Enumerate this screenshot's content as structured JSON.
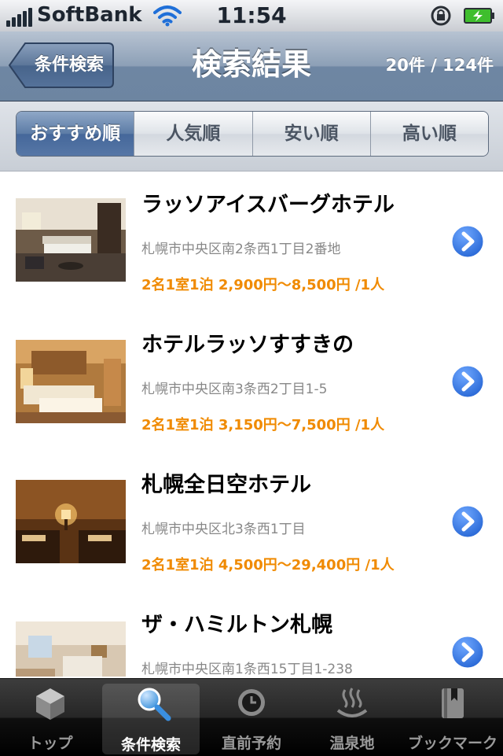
{
  "status": {
    "carrier": "SoftBank",
    "time": "11:54",
    "signal_bars": 5,
    "icons": [
      "signal-bars-icon",
      "wifi-icon",
      "orientation-lock-icon",
      "battery-charging-icon"
    ]
  },
  "nav": {
    "back_label": "条件検索",
    "title": "検索結果",
    "count": "20件 / 124件"
  },
  "sort": {
    "options": [
      "おすすめ順",
      "人気順",
      "安い順",
      "高い順"
    ],
    "selected": "おすすめ順"
  },
  "hotels": [
    {
      "name": "ラッソアイスバーグホテル",
      "address": "札幌市中央区南2条西1丁目2番地",
      "price": "2名1室1泊 2,900円〜8,500円 /1人"
    },
    {
      "name": "ホテルラッソすすきの",
      "address": "札幌市中央区南3条西2丁目1-5",
      "price": "2名1室1泊 3,150円〜7,500円 /1人"
    },
    {
      "name": "札幌全日空ホテル",
      "address": "札幌市中央区北3条西1丁目",
      "price": "2名1室1泊 4,500円〜29,400円 /1人"
    },
    {
      "name": "ザ・ハミルトン札幌",
      "address": "札幌市中央区南1条西15丁目1-238",
      "price": ""
    }
  ],
  "tabs": [
    {
      "label": "トップ",
      "icon": "box-icon"
    },
    {
      "label": "条件検索",
      "icon": "search-icon"
    },
    {
      "label": "直前予約",
      "icon": "clock-icon"
    },
    {
      "label": "温泉地",
      "icon": "hot-spring-icon"
    },
    {
      "label": "ブックマーク",
      "icon": "bookmark-icon"
    }
  ],
  "active_tab": "条件検索",
  "colors": {
    "nav_blue": "#6e86a3",
    "segment_active": "#45679a",
    "price_orange": "#f08a00",
    "disclosure_blue": "#2f6fdc"
  }
}
